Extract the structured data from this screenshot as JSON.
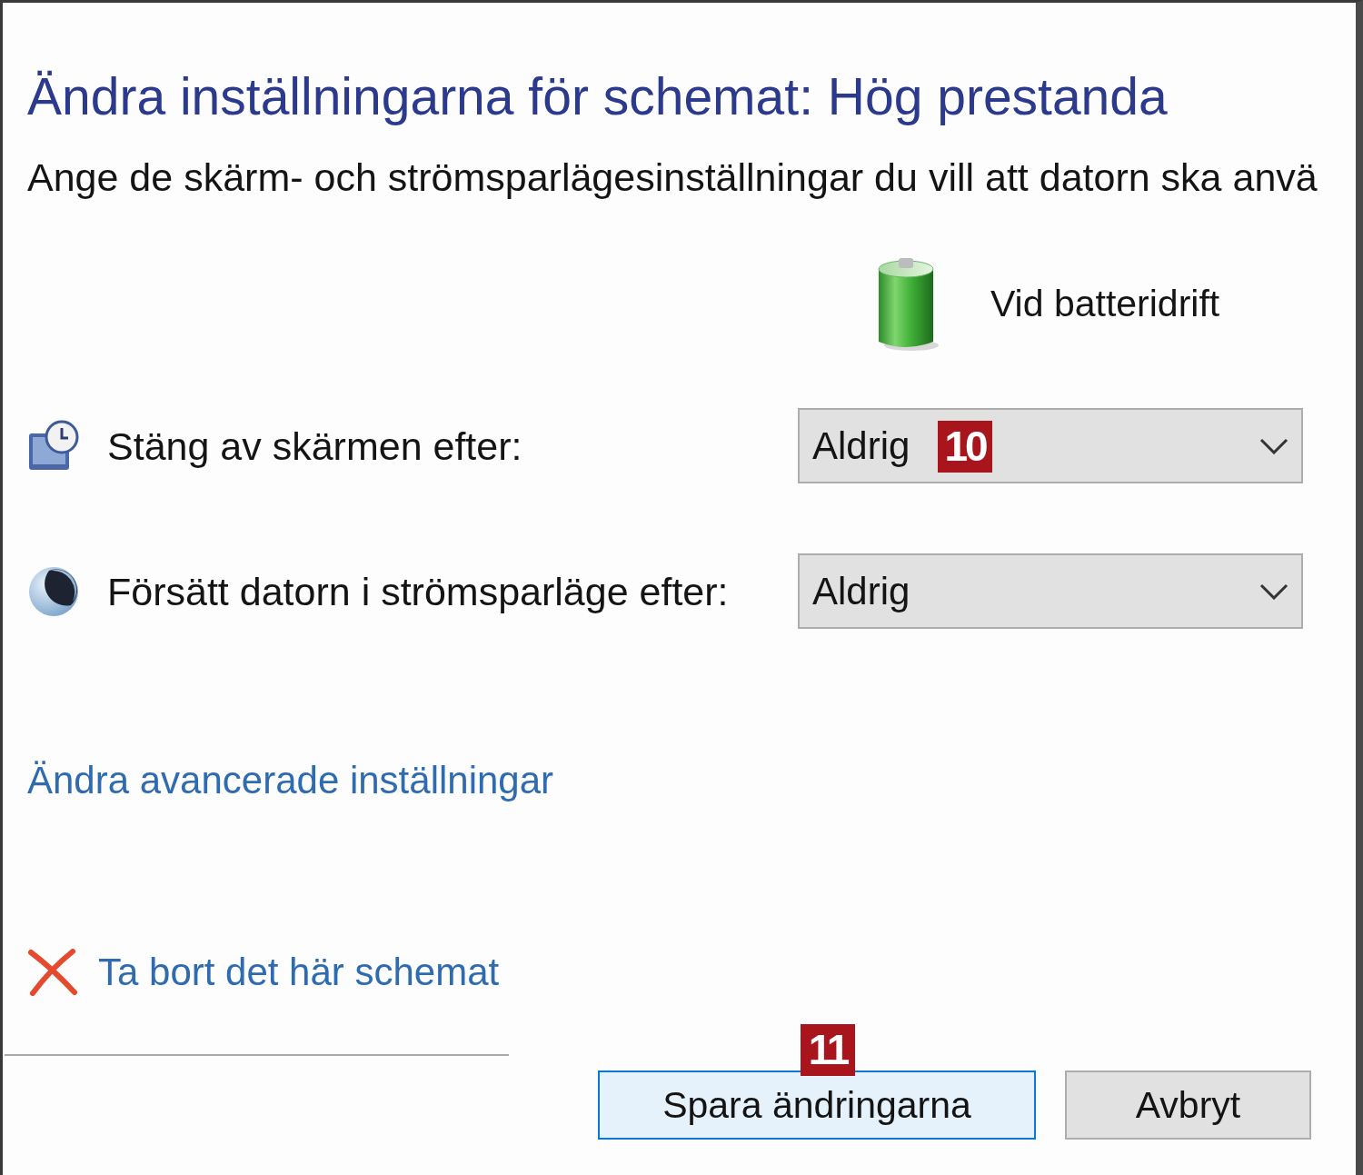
{
  "heading": "Ändra inställningarna för schemat: Hög prestanda",
  "description": "Ange de skärm- och strömsparlägesinställningar du vill att datorn ska anvä",
  "column_header": {
    "label": "Vid batteridrift"
  },
  "settings": [
    {
      "kind": "display",
      "label": "Stäng av skärmen efter:",
      "value": "Aldrig",
      "callout": "10"
    },
    {
      "kind": "sleep",
      "label": "Försätt datorn i strömsparläge efter:",
      "value": "Aldrig"
    }
  ],
  "links": [
    {
      "kind": "advanced",
      "label": "Ändra avancerade inställningar"
    },
    {
      "kind": "delete",
      "label": "Ta bort det här schemat"
    }
  ],
  "buttons": [
    {
      "label": "Spara ändringarna",
      "default": true,
      "callout": "11"
    },
    {
      "label": "Avbryt",
      "default": false
    }
  ]
}
